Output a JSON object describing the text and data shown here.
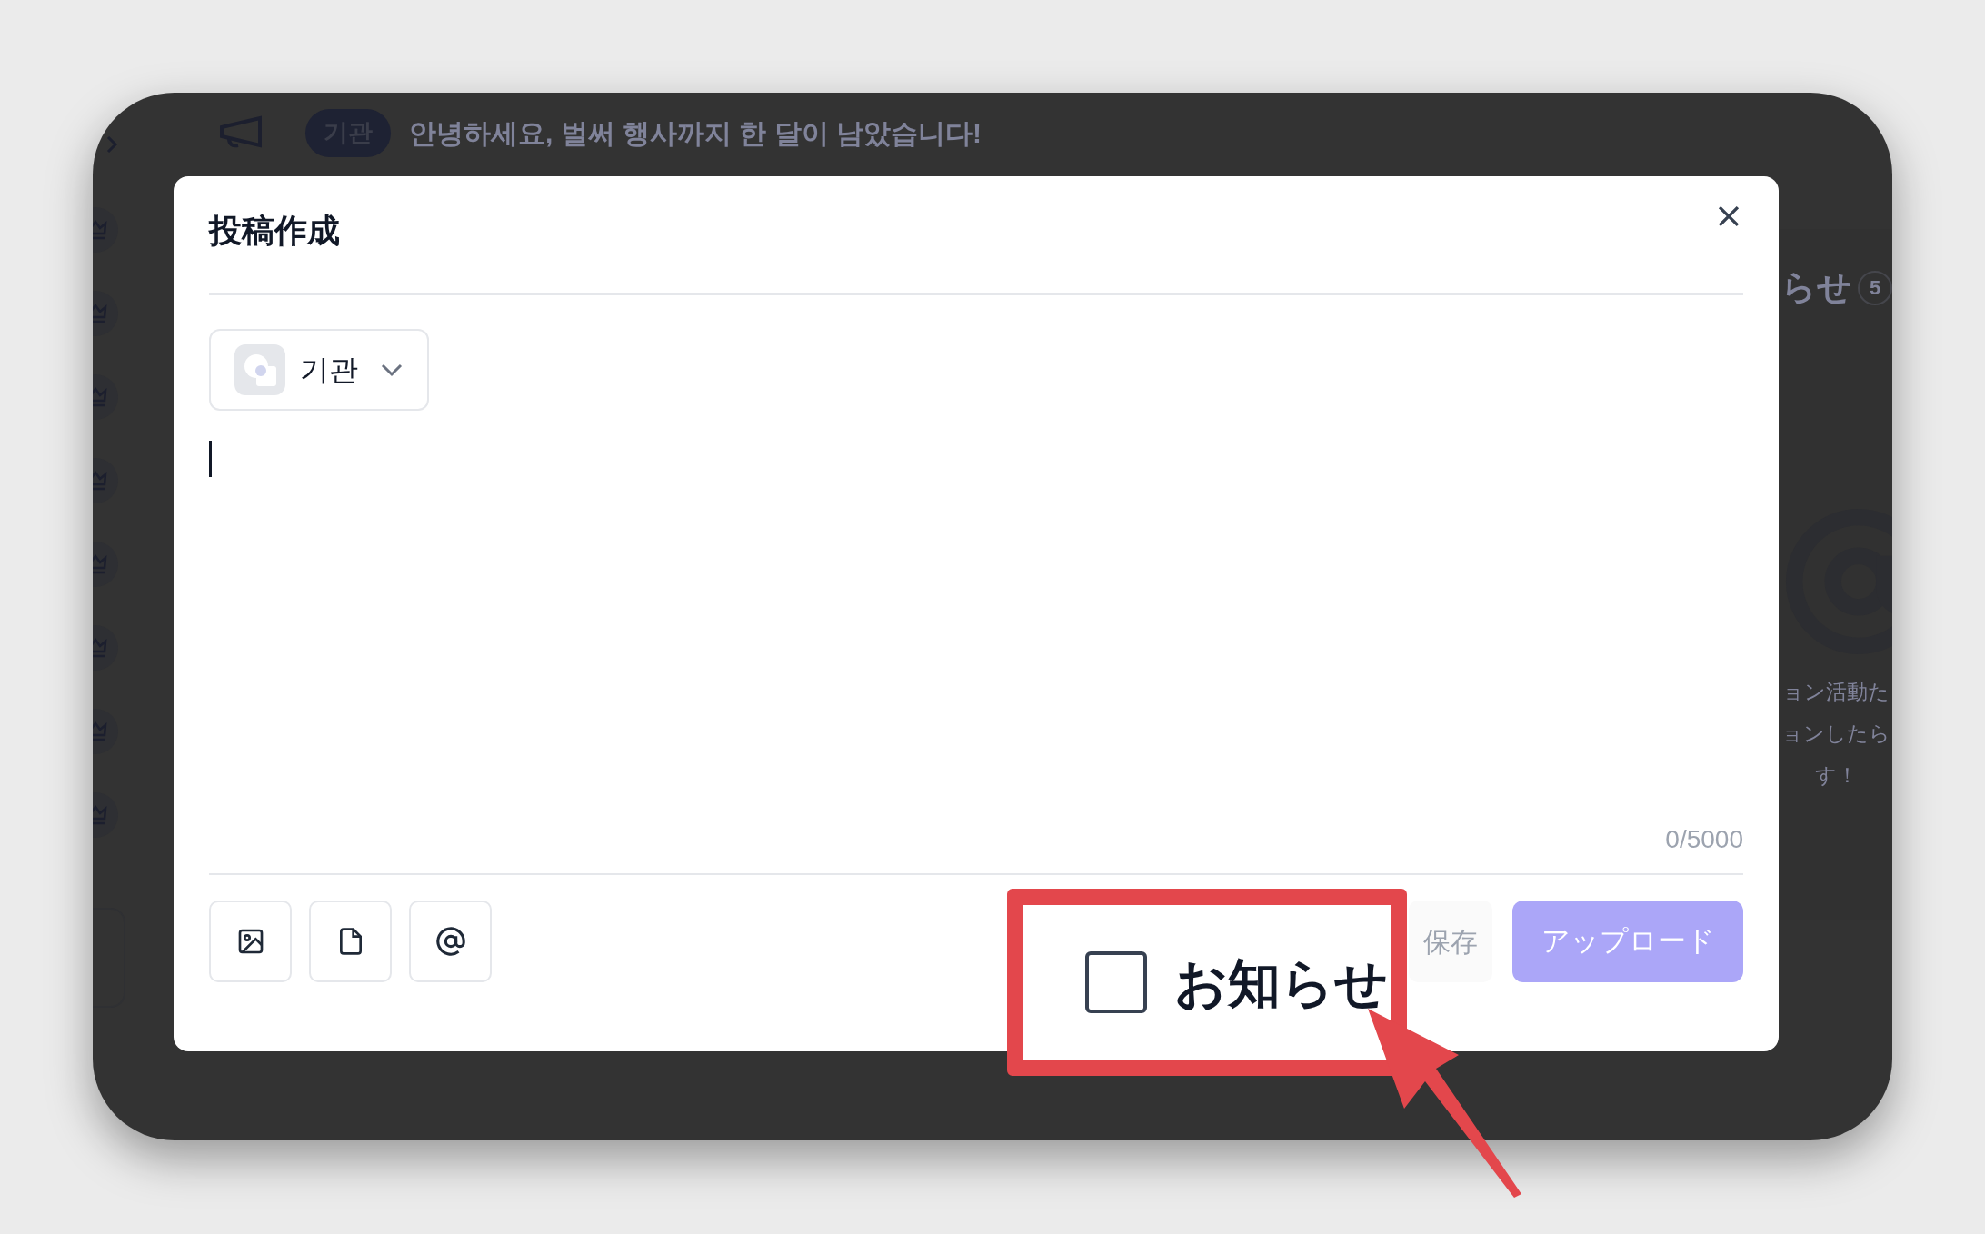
{
  "background": {
    "announcement": {
      "badge": "기관",
      "text": "안녕하세요, 벌써 행사까지 한 달이 남았습니다!"
    },
    "side_panel": {
      "title": "らせ",
      "count": "5",
      "message_lines": [
        "ョン活動た",
        "ョンしたら",
        "す！"
      ]
    }
  },
  "dialog": {
    "title": "投稿作成",
    "author_select": {
      "value": "기관"
    },
    "editor": {
      "counter": "0/5000"
    },
    "toolbar": [
      {
        "kind": "image"
      },
      {
        "kind": "file"
      },
      {
        "kind": "mention"
      }
    ],
    "notice_checkbox": {
      "label": "お知らせ",
      "checked": false
    },
    "save_button": "保存",
    "upload_button": {
      "label": "アップロード",
      "disabled": true
    }
  }
}
